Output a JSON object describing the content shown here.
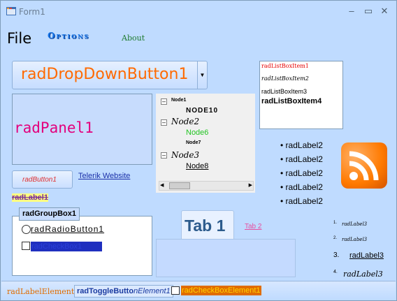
{
  "window": {
    "title": "Form1",
    "minimize": "–",
    "maximize": "▭",
    "close": "✕"
  },
  "menu": {
    "file": "File",
    "options": "Options",
    "about": "About"
  },
  "dropdown": {
    "label": "radDropDownButton1",
    "arrow": "▼"
  },
  "listbox": {
    "items": [
      "radListBoxItem1",
      "radListBoxItem2",
      "radListBoxItem3",
      "radListBoxItem4"
    ]
  },
  "panel": {
    "label": "radPanel1"
  },
  "tree": {
    "nodes": [
      {
        "label": "Node1",
        "expander": "–"
      },
      {
        "label": "NODE10"
      },
      {
        "label": "Node2",
        "expander": "–"
      },
      {
        "label": "Node6"
      },
      {
        "label": "Node7"
      },
      {
        "label": "Node3",
        "expander": "–"
      },
      {
        "label": "Node8"
      }
    ],
    "scroll_left": "◀",
    "scroll_right": "▶"
  },
  "bullet_labels": [
    "radLabel2",
    "radLabel2",
    "radLabel2",
    "radLabel2",
    "radLabel2"
  ],
  "bullet_char": "•",
  "button": {
    "label": "radButton1"
  },
  "link": {
    "label": "Telerik Website"
  },
  "label1": {
    "label": "radLabel1"
  },
  "groupbox": {
    "header": "radGroupBox1",
    "radio": "radRadioButton1",
    "checkbox": "radCheckBox1"
  },
  "tabs": {
    "tab1": "Tab 1",
    "tab2": "Tab 2"
  },
  "ordered": [
    {
      "num": "1.",
      "label": "radLabel3"
    },
    {
      "num": "2.",
      "label": "radLabel3"
    },
    {
      "num": "3.",
      "label": "radLabel3"
    },
    {
      "num": "4.",
      "label": "radLabel3"
    }
  ],
  "status": {
    "label": "radLabelElement",
    "toggle_bold": "radToggleButto",
    "toggle_italic": "nElement1",
    "checkbox": "radCheckBoxElement1"
  }
}
